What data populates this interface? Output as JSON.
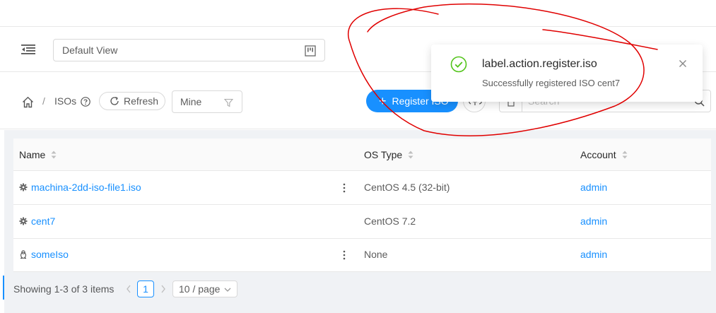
{
  "header": {
    "view_select_value": "Default View"
  },
  "breadcrumb": {
    "separator": "/",
    "current": "ISOs"
  },
  "toolbar": {
    "refresh_label": "Refresh",
    "filter_value": "Mine",
    "register_label": "Register ISO",
    "search_placeholder": "Search"
  },
  "table": {
    "columns": [
      "Name",
      "OS Type",
      "Account"
    ],
    "rows": [
      {
        "name": "machina-2dd-iso-file1.iso",
        "icon": "gear-icon",
        "os_type": "CentOS 4.5 (32-bit)",
        "account": "admin",
        "has_actions": true
      },
      {
        "name": "cent7",
        "icon": "gear-icon",
        "os_type": "CentOS 7.2",
        "account": "admin",
        "has_actions": false
      },
      {
        "name": "someIso",
        "icon": "linux-icon",
        "os_type": "None",
        "account": "admin",
        "has_actions": true
      }
    ]
  },
  "pagination": {
    "total_text": "Showing 1-3 of 3 items",
    "current_page": "1",
    "page_size": "10 / page"
  },
  "notification": {
    "title": "label.action.register.iso",
    "description": "Successfully registered ISO cent7",
    "status": "success"
  },
  "colors": {
    "primary": "#1890ff",
    "success": "#52c41a",
    "annotation": "#e00000"
  }
}
